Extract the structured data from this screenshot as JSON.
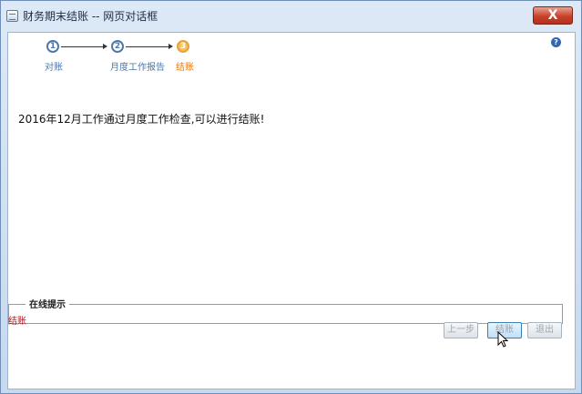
{
  "window": {
    "title": "财务期末结账 -- 网页对话框",
    "close_label": "X"
  },
  "help": {
    "label": "?"
  },
  "wizard": {
    "steps": [
      {
        "number": "1",
        "label": "对账"
      },
      {
        "number": "2",
        "label": "月度工作报告"
      },
      {
        "number": "3",
        "label": "结账"
      }
    ]
  },
  "main": {
    "message": "2016年12月工作通过月度工作检查,可以进行结账!"
  },
  "hint": {
    "title": "在线提示",
    "text": "结账"
  },
  "buttons": {
    "prev": "上一步",
    "close_period": "结账",
    "exit": "退出"
  },
  "colors": {
    "step_active": "#e9a23b",
    "step_inactive": "#4d78a8",
    "hint_text": "#c8101a"
  }
}
